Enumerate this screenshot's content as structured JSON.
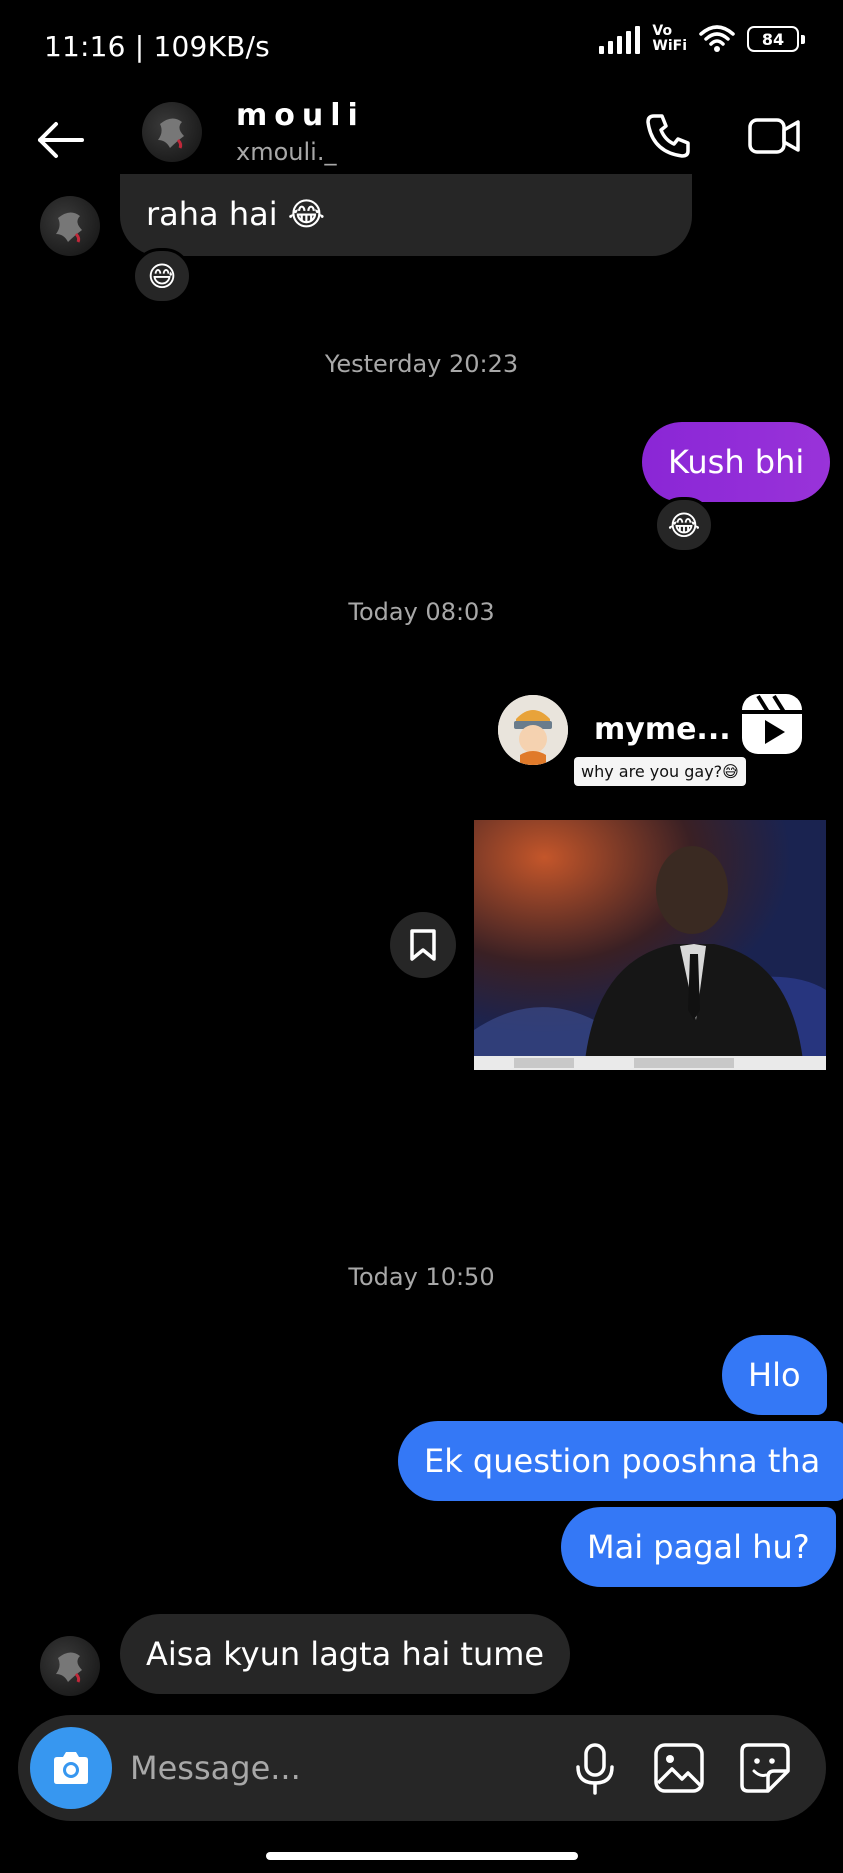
{
  "status_bar": {
    "time_speed": "11:16 | 109KB/s",
    "vowifi_line1": "Vo",
    "vowifi_line2": "WiFi",
    "battery": "84"
  },
  "header": {
    "name": "mouli",
    "username": "xmouli._",
    "icons": [
      "back-arrow-icon",
      "phone-icon",
      "video-icon"
    ]
  },
  "messages": [
    {
      "id": "m1",
      "sender": "them",
      "text": "raha hai 😂",
      "reaction": "😅"
    },
    {
      "id": "t1",
      "type": "timestamp",
      "text": "Yesterday 20:23"
    },
    {
      "id": "m2",
      "sender": "me",
      "text": "Kush bhi",
      "reaction": "😂"
    },
    {
      "id": "t2",
      "type": "timestamp",
      "text": "Today 08:03"
    },
    {
      "id": "m3",
      "sender": "me",
      "type": "reel",
      "account": "myme...",
      "caption": "why are you gay?😅"
    },
    {
      "id": "t3",
      "type": "timestamp",
      "text": "Today 10:50"
    },
    {
      "id": "m4",
      "sender": "me",
      "text": "Hlo"
    },
    {
      "id": "m5",
      "sender": "me",
      "text": "Ek question pooshna tha"
    },
    {
      "id": "m6",
      "sender": "me",
      "text": "Mai pagal hu?"
    },
    {
      "id": "m7",
      "sender": "them",
      "text": "Aisa kyun lagta hai tume"
    }
  ],
  "composer": {
    "placeholder": "Message..."
  },
  "colors": {
    "background": "#000000",
    "bubble_gray": "#262626",
    "bubble_purple": "#8a26d6",
    "bubble_blue": "#3478f6",
    "camera_blue": "#3797f0"
  }
}
